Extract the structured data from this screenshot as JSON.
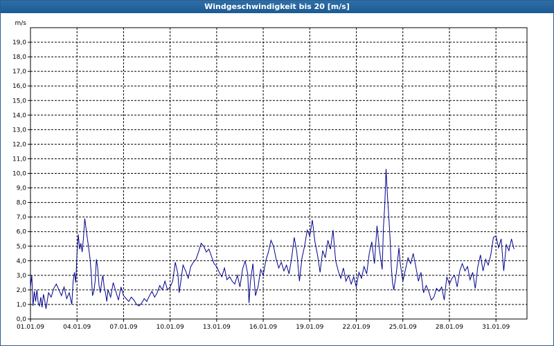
{
  "window": {
    "title": "Windgeschwindigkeit bis 20 [m/s]"
  },
  "colors": {
    "titlebar": "#1f5f99",
    "series": "#00008b",
    "grid": "#000000"
  },
  "chart_data": {
    "type": "line",
    "title": "Windgeschwindigkeit bis 20 [m/s]",
    "ylabel": "m/s",
    "xlabel": "",
    "ylim": [
      0,
      20
    ],
    "xlim": [
      "01.01.09",
      "02.02.09"
    ],
    "grid": true,
    "y_ticks": [
      "0,0",
      "1,0",
      "2,0",
      "3,0",
      "4,0",
      "5,0",
      "6,0",
      "7,0",
      "8,0",
      "9,0",
      "10,0",
      "11,0",
      "12,0",
      "13,0",
      "14,0",
      "15,0",
      "16,0",
      "17,0",
      "18,0",
      "19,0"
    ],
    "x_ticks": [
      "01.01.09",
      "04.01.09",
      "07.01.09",
      "10.01.09",
      "13.01.09",
      "16.01.09",
      "19.01.09",
      "22.01.09",
      "25.01.09",
      "28.01.09",
      "31.01.09"
    ],
    "series": [
      {
        "points": [
          [
            "01.01.09 00:00",
            2.2
          ],
          [
            "01.01.09 02:00",
            3.0
          ],
          [
            "01.01.09 04:00",
            0.9
          ],
          [
            "01.01.09 06:00",
            1.9
          ],
          [
            "01.01.09 08:00",
            1.2
          ],
          [
            "01.01.09 10:00",
            2.0
          ],
          [
            "01.01.09 12:00",
            1.1
          ],
          [
            "01.01.09 14:00",
            0.9
          ],
          [
            "01.01.09 16:00",
            1.5
          ],
          [
            "01.01.09 18:00",
            0.8
          ],
          [
            "01.01.09 20:00",
            1.7
          ],
          [
            "01.01.09 22:00",
            1.3
          ],
          [
            "02.01.09 00:00",
            0.7
          ],
          [
            "02.01.09 04:00",
            1.8
          ],
          [
            "02.01.09 08:00",
            1.5
          ],
          [
            "02.01.09 12:00",
            2.1
          ],
          [
            "02.01.09 16:00",
            2.4
          ],
          [
            "02.01.09 20:00",
            2.0
          ],
          [
            "03.01.09 00:00",
            1.6
          ],
          [
            "03.01.09 04:00",
            2.2
          ],
          [
            "03.01.09 08:00",
            1.4
          ],
          [
            "03.01.09 12:00",
            1.8
          ],
          [
            "03.01.09 16:00",
            1.0
          ],
          [
            "03.01.09 18:00",
            2.6
          ],
          [
            "03.01.09 20:00",
            3.2
          ],
          [
            "03.01.09 22:00",
            2.5
          ],
          [
            "04.01.09 00:00",
            4.5
          ],
          [
            "04.01.09 02:00",
            5.8
          ],
          [
            "04.01.09 04:00",
            4.8
          ],
          [
            "04.01.09 06:00",
            5.2
          ],
          [
            "04.01.09 08:00",
            4.6
          ],
          [
            "04.01.09 10:00",
            5.6
          ],
          [
            "04.01.09 12:00",
            6.9
          ],
          [
            "04.01.09 14:00",
            6.2
          ],
          [
            "04.01.09 16:00",
            5.5
          ],
          [
            "04.01.09 18:00",
            4.9
          ],
          [
            "04.01.09 20:00",
            4.2
          ],
          [
            "04.01.09 22:00",
            3.1
          ],
          [
            "05.01.09 00:00",
            1.6
          ],
          [
            "05.01.09 02:00",
            1.9
          ],
          [
            "05.01.09 04:00",
            2.6
          ],
          [
            "05.01.09 06:00",
            4.1
          ],
          [
            "05.01.09 08:00",
            3.5
          ],
          [
            "05.01.09 10:00",
            2.3
          ],
          [
            "05.01.09 12:00",
            1.8
          ],
          [
            "05.01.09 14:00",
            2.5
          ],
          [
            "05.01.09 16:00",
            3.0
          ],
          [
            "05.01.09 18:00",
            2.2
          ],
          [
            "05.01.09 20:00",
            1.8
          ],
          [
            "05.01.09 22:00",
            1.2
          ],
          [
            "06.01.09 00:00",
            2.0
          ],
          [
            "06.01.09 04:00",
            1.5
          ],
          [
            "06.01.09 08:00",
            2.5
          ],
          [
            "06.01.09 12:00",
            1.9
          ],
          [
            "06.01.09 16:00",
            1.3
          ],
          [
            "06.01.09 20:00",
            2.2
          ],
          [
            "07.01.09 00:00",
            1.6
          ],
          [
            "07.01.09 04:00",
            1.4
          ],
          [
            "07.01.09 08:00",
            1.2
          ],
          [
            "07.01.09 12:00",
            1.5
          ],
          [
            "07.01.09 16:00",
            1.3
          ],
          [
            "07.01.09 20:00",
            1.0
          ],
          [
            "08.01.09 00:00",
            0.9
          ],
          [
            "08.01.09 04:00",
            1.1
          ],
          [
            "08.01.09 08:00",
            1.4
          ],
          [
            "08.01.09 12:00",
            1.2
          ],
          [
            "08.01.09 16:00",
            1.6
          ],
          [
            "08.01.09 20:00",
            1.9
          ],
          [
            "09.01.09 00:00",
            1.5
          ],
          [
            "09.01.09 04:00",
            1.8
          ],
          [
            "09.01.09 08:00",
            2.3
          ],
          [
            "09.01.09 12:00",
            2.0
          ],
          [
            "09.01.09 16:00",
            2.6
          ],
          [
            "09.01.09 20:00",
            2.0
          ],
          [
            "10.01.09 00:00",
            2.2
          ],
          [
            "10.01.09 04:00",
            2.6
          ],
          [
            "10.01.09 08:00",
            3.9
          ],
          [
            "10.01.09 12:00",
            3.1
          ],
          [
            "10.01.09 14:00",
            1.8
          ],
          [
            "10.01.09 16:00",
            2.4
          ],
          [
            "10.01.09 20:00",
            3.7
          ],
          [
            "11.01.09 00:00",
            3.3
          ],
          [
            "11.01.09 04:00",
            2.8
          ],
          [
            "11.01.09 08:00",
            3.6
          ],
          [
            "11.01.09 12:00",
            3.9
          ],
          [
            "11.01.09 16:00",
            4.1
          ],
          [
            "11.01.09 20:00",
            4.6
          ],
          [
            "12.01.09 00:00",
            5.2
          ],
          [
            "12.01.09 04:00",
            5.0
          ],
          [
            "12.01.09 08:00",
            4.6
          ],
          [
            "12.01.09 12:00",
            4.8
          ],
          [
            "12.01.09 16:00",
            4.3
          ],
          [
            "12.01.09 20:00",
            3.8
          ],
          [
            "13.01.09 00:00",
            3.6
          ],
          [
            "13.01.09 04:00",
            3.2
          ],
          [
            "13.01.09 08:00",
            2.9
          ],
          [
            "13.01.09 12:00",
            3.5
          ],
          [
            "13.01.09 16:00",
            2.7
          ],
          [
            "13.01.09 20:00",
            2.9
          ],
          [
            "14.01.09 00:00",
            2.6
          ],
          [
            "14.01.09 04:00",
            2.4
          ],
          [
            "14.01.09 08:00",
            3.0
          ],
          [
            "14.01.09 12:00",
            2.2
          ],
          [
            "14.01.09 16:00",
            3.4
          ],
          [
            "14.01.09 20:00",
            4.0
          ],
          [
            "15.01.09 00:00",
            3.1
          ],
          [
            "15.01.09 02:00",
            1.1
          ],
          [
            "15.01.09 04:00",
            2.5
          ],
          [
            "15.01.09 08:00",
            3.8
          ],
          [
            "15.01.09 12:00",
            1.6
          ],
          [
            "15.01.09 16:00",
            2.2
          ],
          [
            "15.01.09 20:00",
            3.4
          ],
          [
            "16.01.09 00:00",
            3.0
          ],
          [
            "16.01.09 04:00",
            4.0
          ],
          [
            "16.01.09 08:00",
            4.6
          ],
          [
            "16.01.09 12:00",
            5.4
          ],
          [
            "16.01.09 16:00",
            5.0
          ],
          [
            "16.01.09 20:00",
            4.1
          ],
          [
            "17.01.09 00:00",
            3.5
          ],
          [
            "17.01.09 04:00",
            3.9
          ],
          [
            "17.01.09 08:00",
            3.3
          ],
          [
            "17.01.09 12:00",
            3.7
          ],
          [
            "17.01.09 16:00",
            3.1
          ],
          [
            "17.01.09 20:00",
            4.2
          ],
          [
            "18.01.09 00:00",
            5.6
          ],
          [
            "18.01.09 04:00",
            4.6
          ],
          [
            "18.01.09 08:00",
            2.6
          ],
          [
            "18.01.09 12:00",
            4.2
          ],
          [
            "18.01.09 16:00",
            5.0
          ],
          [
            "18.01.09 20:00",
            6.1
          ],
          [
            "19.01.09 00:00",
            5.7
          ],
          [
            "19.01.09 04:00",
            6.8
          ],
          [
            "19.01.09 08:00",
            5.3
          ],
          [
            "19.01.09 12:00",
            4.4
          ],
          [
            "19.01.09 16:00",
            3.2
          ],
          [
            "19.01.09 20:00",
            4.7
          ],
          [
            "20.01.09 00:00",
            4.2
          ],
          [
            "20.01.09 04:00",
            5.4
          ],
          [
            "20.01.09 08:00",
            4.8
          ],
          [
            "20.01.09 12:00",
            6.1
          ],
          [
            "20.01.09 16:00",
            4.0
          ],
          [
            "20.01.09 20:00",
            3.3
          ],
          [
            "21.01.09 00:00",
            2.8
          ],
          [
            "21.01.09 04:00",
            3.5
          ],
          [
            "21.01.09 08:00",
            2.6
          ],
          [
            "21.01.09 12:00",
            3.0
          ],
          [
            "21.01.09 16:00",
            2.4
          ],
          [
            "21.01.09 20:00",
            2.9
          ],
          [
            "22.01.09 00:00",
            2.2
          ],
          [
            "22.01.09 04:00",
            3.2
          ],
          [
            "22.01.09 08:00",
            2.8
          ],
          [
            "22.01.09 12:00",
            3.6
          ],
          [
            "22.01.09 16:00",
            3.1
          ],
          [
            "22.01.09 20:00",
            4.5
          ],
          [
            "23.01.09 00:00",
            5.3
          ],
          [
            "23.01.09 04:00",
            3.8
          ],
          [
            "23.01.09 08:00",
            6.4
          ],
          [
            "23.01.09 12:00",
            4.7
          ],
          [
            "23.01.09 16:00",
            3.4
          ],
          [
            "23.01.09 18:00",
            6.3
          ],
          [
            "23.01.09 20:00",
            7.8
          ],
          [
            "23.01.09 22:00",
            10.3
          ],
          [
            "24.01.09 00:00",
            8.6
          ],
          [
            "24.01.09 02:00",
            7.2
          ],
          [
            "24.01.09 04:00",
            5.7
          ],
          [
            "24.01.09 06:00",
            3.7
          ],
          [
            "24.01.09 08:00",
            2.5
          ],
          [
            "24.01.09 10:00",
            2.0
          ],
          [
            "24.01.09 14:00",
            3.2
          ],
          [
            "24.01.09 18:00",
            4.9
          ],
          [
            "24.01.09 20:00",
            3.8
          ],
          [
            "25.01.09 00:00",
            2.6
          ],
          [
            "25.01.09 04:00",
            3.4
          ],
          [
            "25.01.09 08:00",
            4.2
          ],
          [
            "25.01.09 12:00",
            3.8
          ],
          [
            "25.01.09 16:00",
            4.5
          ],
          [
            "25.01.09 20:00",
            3.6
          ],
          [
            "26.01.09 00:00",
            2.6
          ],
          [
            "26.01.09 04:00",
            3.2
          ],
          [
            "26.01.09 08:00",
            1.8
          ],
          [
            "26.01.09 12:00",
            2.3
          ],
          [
            "26.01.09 16:00",
            1.9
          ],
          [
            "26.01.09 20:00",
            1.3
          ],
          [
            "27.01.09 00:00",
            1.5
          ],
          [
            "27.01.09 04:00",
            2.1
          ],
          [
            "27.01.09 08:00",
            1.9
          ],
          [
            "27.01.09 12:00",
            2.2
          ],
          [
            "27.01.09 16:00",
            1.3
          ],
          [
            "27.01.09 20:00",
            2.9
          ],
          [
            "28.01.09 00:00",
            2.4
          ],
          [
            "28.01.09 04:00",
            2.8
          ],
          [
            "28.01.09 08:00",
            3.0
          ],
          [
            "28.01.09 12:00",
            2.2
          ],
          [
            "28.01.09 16:00",
            3.3
          ],
          [
            "28.01.09 20:00",
            3.8
          ],
          [
            "29.01.09 00:00",
            3.3
          ],
          [
            "29.01.09 04:00",
            3.6
          ],
          [
            "29.01.09 08:00",
            2.7
          ],
          [
            "29.01.09 12:00",
            3.2
          ],
          [
            "29.01.09 16:00",
            2.1
          ],
          [
            "29.01.09 20:00",
            3.6
          ],
          [
            "30.01.09 00:00",
            4.4
          ],
          [
            "30.01.09 04:00",
            3.3
          ],
          [
            "30.01.09 08:00",
            4.1
          ],
          [
            "30.01.09 12:00",
            3.7
          ],
          [
            "30.01.09 16:00",
            4.4
          ],
          [
            "30.01.09 20:00",
            5.6
          ],
          [
            "31.01.09 00:00",
            5.7
          ],
          [
            "31.01.09 04:00",
            4.9
          ],
          [
            "31.01.09 08:00",
            5.5
          ],
          [
            "31.01.09 12:00",
            3.3
          ],
          [
            "31.01.09 16:00",
            5.1
          ],
          [
            "31.01.09 20:00",
            4.7
          ],
          [
            "01.02.09 00:00",
            5.5
          ],
          [
            "01.02.09 04:00",
            4.8
          ]
        ]
      }
    ]
  }
}
